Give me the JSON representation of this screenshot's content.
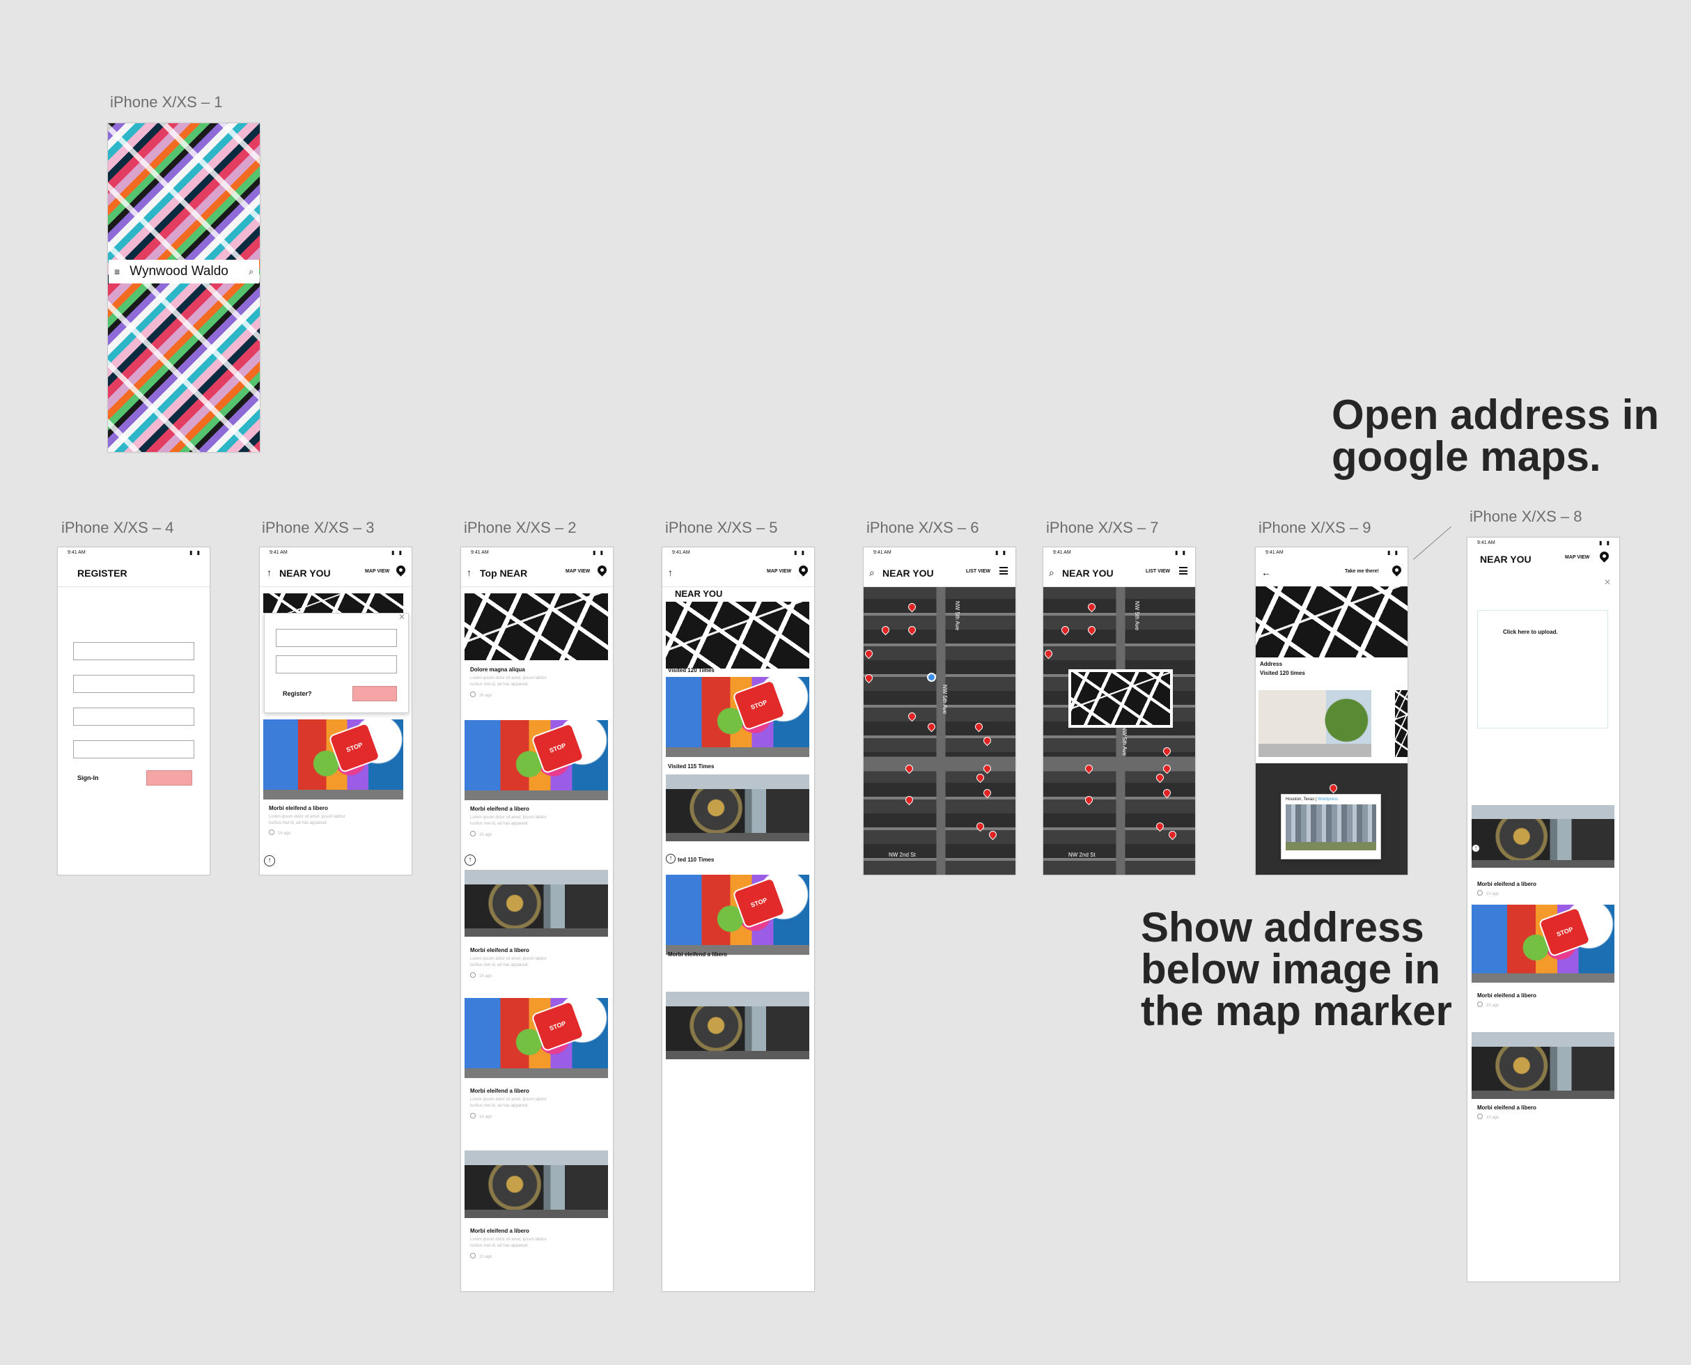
{
  "artboards": {
    "a1": {
      "label": "iPhone X/XS – 1",
      "title": "Wynwood Waldo"
    },
    "a4": {
      "label": "iPhone X/XS – 4",
      "title": "REGISTER",
      "signin_label": "Sign-In",
      "time": "9:41 AM"
    },
    "a3": {
      "label": "iPhone X/XS – 3",
      "title": "NEAR YOU",
      "action": "MAP VIEW",
      "register_label": "Register?",
      "card_title": "Morbi eleifend a libero",
      "card_text": "Lorem ipsum dolor sit amet, ipsum labitur\nlucilius mel id, ad has appareat.",
      "card_time": "1h ago",
      "time": "9:41 AM"
    },
    "a2": {
      "label": "iPhone X/XS – 2",
      "title": "Top NEAR",
      "action": "MAP VIEW",
      "time": "9:41 AM",
      "cards": [
        {
          "title": "Dolore magna aliqua",
          "text": "Lorem ipsum dolor sit amet, ipsum labitur\nlucilius mel id, ad has appareat.",
          "time": "2h ago"
        },
        {
          "title": "Morbi eleifend a libero",
          "text": "Lorem ipsum dolor sit amet, ipsum labitur\nlucilius mel id, ad has appareat.",
          "time": "1h ago"
        },
        {
          "title": "Morbi eleifend a libero",
          "text": "Lorem ipsum dolor sit amet, ipsum labitur\nlucilius mel id, ad has appareat.",
          "time": "1h ago"
        },
        {
          "title": "Morbi eleifend a libero",
          "text": "Lorem ipsum dolor sit amet, ipsum labitur\nlucilius mel id, ad has appareat.",
          "time": "1h ago"
        },
        {
          "title": "Morbi eleifend a libero",
          "text": "Lorem ipsum dolor sit amet, ipsum labitur\nlucilius mel id, ad has appareat.",
          "time": "1h ago"
        }
      ]
    },
    "a5": {
      "label": "iPhone X/XS – 5",
      "title": "NEAR YOU",
      "action": "MAP VIEW",
      "time": "9:41 AM",
      "captions": [
        "Visited 120 Times",
        "Visited 115 Times",
        "ted 110 Times",
        "Morbi eleifend a libero"
      ]
    },
    "a6": {
      "label": "iPhone X/XS – 6",
      "title": "NEAR YOU",
      "action": "LIST VIEW",
      "time": "9:41 AM",
      "street": "NW 5th Ave",
      "street2": "NW 2nd St"
    },
    "a7": {
      "label": "iPhone X/XS – 7",
      "title": "NEAR YOU",
      "action": "LIST VIEW",
      "time": "9:41 AM",
      "street": "NW 5th Ave",
      "street2": "NW 2nd St"
    },
    "a9": {
      "label": "iPhone X/XS – 9",
      "action": "Take me there!",
      "time": "9:41 AM",
      "address": "Address",
      "visited": "Visited 120 times",
      "map_caption_place": "Houston, Texas | ",
      "map_caption_link": "Wordpress"
    },
    "a8": {
      "label": "iPhone X/XS – 8",
      "title": "NEAR YOU",
      "action": "MAP VIEW",
      "time": "9:41 AM",
      "upload_text": "Click here to upload.",
      "cards": [
        {
          "title": "Morbi eleifend a libero",
          "time": "1h ago"
        },
        {
          "title": "Morbi eleifend a libero",
          "time": "1h ago"
        },
        {
          "title": "Morbi eleifend a libero",
          "time": "1h ago"
        }
      ]
    }
  },
  "annotations": {
    "open_address": "Open address in\ngoogle maps.",
    "show_address": "Show address\nbelow image in\nthe map marker"
  },
  "colors": {
    "canvas": "#e5e5e5",
    "accent_pink": "#f6a5a6",
    "map_pin": "#e02424",
    "location_dot": "#3b8de8"
  }
}
